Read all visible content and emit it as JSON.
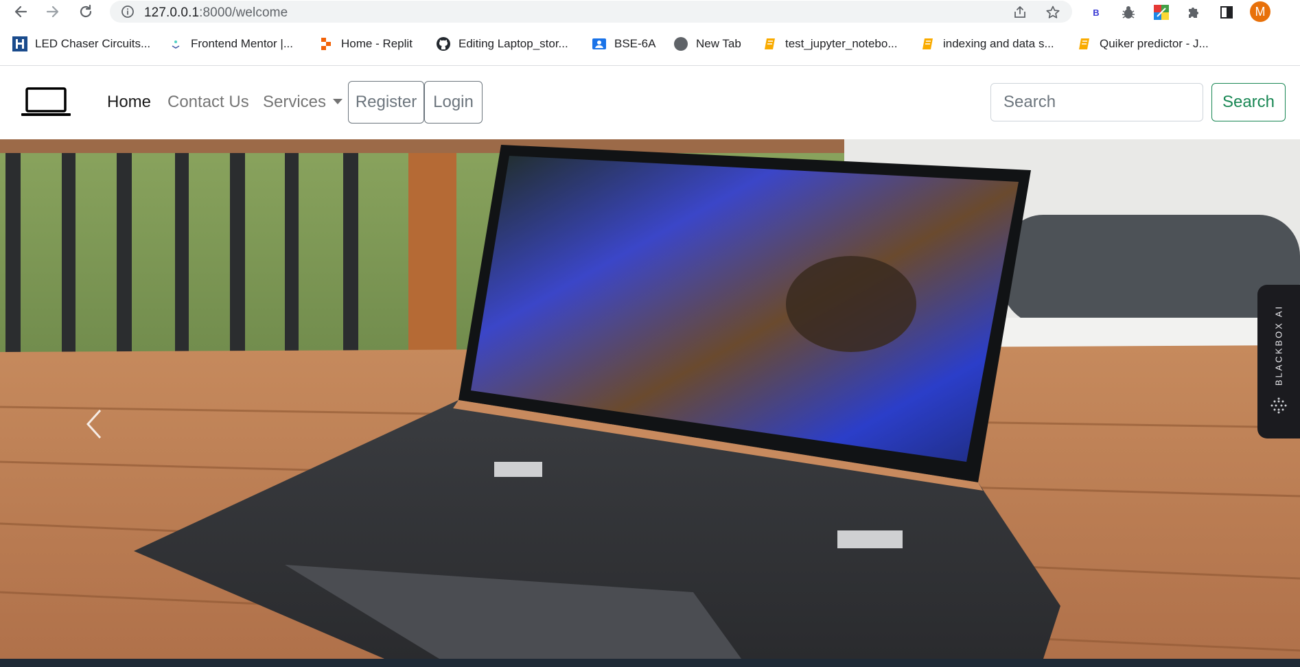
{
  "browser": {
    "url_host": "127.0.0.1",
    "url_path": ":8000/welcome",
    "profile_initial": "M",
    "extension_b_label": "B"
  },
  "bookmarks": [
    {
      "label": "LED Chaser Circuits...",
      "icon": "led-chaser-favicon"
    },
    {
      "label": "Frontend Mentor |...",
      "icon": "frontend-mentor-favicon"
    },
    {
      "label": "Home - Replit",
      "icon": "replit-favicon"
    },
    {
      "label": "Editing Laptop_stor...",
      "icon": "github-favicon"
    },
    {
      "label": "BSE-6A",
      "icon": "classroom-favicon"
    },
    {
      "label": "New Tab",
      "icon": "new-tab-favicon"
    },
    {
      "label": "test_jupyter_notebo...",
      "icon": "notebook-favicon"
    },
    {
      "label": "indexing and data s...",
      "icon": "notebook-favicon"
    },
    {
      "label": "Quiker predictor - J...",
      "icon": "notebook-favicon"
    }
  ],
  "navbar": {
    "brand_icon": "laptop-icon",
    "links": {
      "home": "Home",
      "contact": "Contact Us",
      "services": "Services"
    },
    "register_label": "Register",
    "login_label": "Login",
    "search_placeholder": "Search",
    "search_button": "Search"
  },
  "hero": {
    "image": "laptop-on-wooden-table",
    "prev_icon": "carousel-prev-icon"
  },
  "blackbox_widget": {
    "label": "BLACKBOX AI"
  },
  "colors": {
    "search_button": "#198754",
    "outline_button": "#6c757d",
    "profile_avatar": "#e8710a",
    "blackbox_bg": "#1b1b1f"
  }
}
